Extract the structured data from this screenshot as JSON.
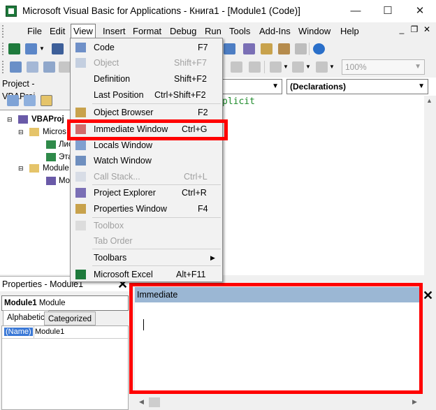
{
  "window": {
    "title": "Microsoft Visual Basic for Applications - Книга1 - [Module1 (Code)]",
    "min_glyph": "—",
    "max_glyph": "☐",
    "close_glyph": "✕"
  },
  "menubar": {
    "items": [
      "File",
      "Edit",
      "View",
      "Insert",
      "Format",
      "Debug",
      "Run",
      "Tools",
      "Add-Ins",
      "Window",
      "Help"
    ],
    "mdi_min": "_",
    "mdi_restore": "❐",
    "mdi_close": "✕"
  },
  "toolbar2": {
    "zoom_value": "100%"
  },
  "project": {
    "title": "Project - VBAProj",
    "tree": {
      "root": "VBAProj",
      "folder1": "Micros",
      "item1": "Лис",
      "item2": "Эта",
      "folder2": "Module",
      "item3": "Mo"
    }
  },
  "code": {
    "object_combo": "",
    "proc_combo": "(Declarations)",
    "first_line": "plicit"
  },
  "properties": {
    "title": "Properties - Module1",
    "object_name": "Module1",
    "object_type": "Module",
    "tabs": [
      "Alphabetic",
      "Categorized"
    ],
    "rows": [
      {
        "name": "(Name)",
        "value": "Module1"
      }
    ],
    "close_glyph": "✕"
  },
  "immediate": {
    "title": "Immediate",
    "close_glyph": "✕"
  },
  "view_menu": {
    "items": [
      {
        "label": "Code",
        "shortcut": "F7",
        "enabled": true
      },
      {
        "label": "Object",
        "shortcut": "Shift+F7",
        "enabled": false
      },
      {
        "label": "Definition",
        "shortcut": "Shift+F2",
        "enabled": true
      },
      {
        "label": "Last Position",
        "shortcut": "Ctrl+Shift+F2",
        "enabled": true
      },
      {
        "label": "Object Browser",
        "shortcut": "F2",
        "enabled": true
      },
      {
        "label": "Immediate Window",
        "shortcut": "Ctrl+G",
        "enabled": true
      },
      {
        "label": "Locals Window",
        "shortcut": "",
        "enabled": true
      },
      {
        "label": "Watch Window",
        "shortcut": "",
        "enabled": true
      },
      {
        "label": "Call Stack...",
        "shortcut": "Ctrl+L",
        "enabled": false
      },
      {
        "label": "Project Explorer",
        "shortcut": "Ctrl+R",
        "enabled": true
      },
      {
        "label": "Properties Window",
        "shortcut": "F4",
        "enabled": true
      },
      {
        "label": "Toolbox",
        "shortcut": "",
        "enabled": false
      },
      {
        "label": "Tab Order",
        "shortcut": "",
        "enabled": false
      },
      {
        "label": "Toolbars",
        "shortcut": "",
        "enabled": true
      },
      {
        "label": "Microsoft Excel",
        "shortcut": "Alt+F11",
        "enabled": true
      }
    ]
  },
  "colors": {
    "highlight_red": "#ff0000",
    "immediate_titlebar": "#9bb7d4",
    "code_green": "#1d8a2a",
    "selection_blue": "#3a78d6"
  }
}
